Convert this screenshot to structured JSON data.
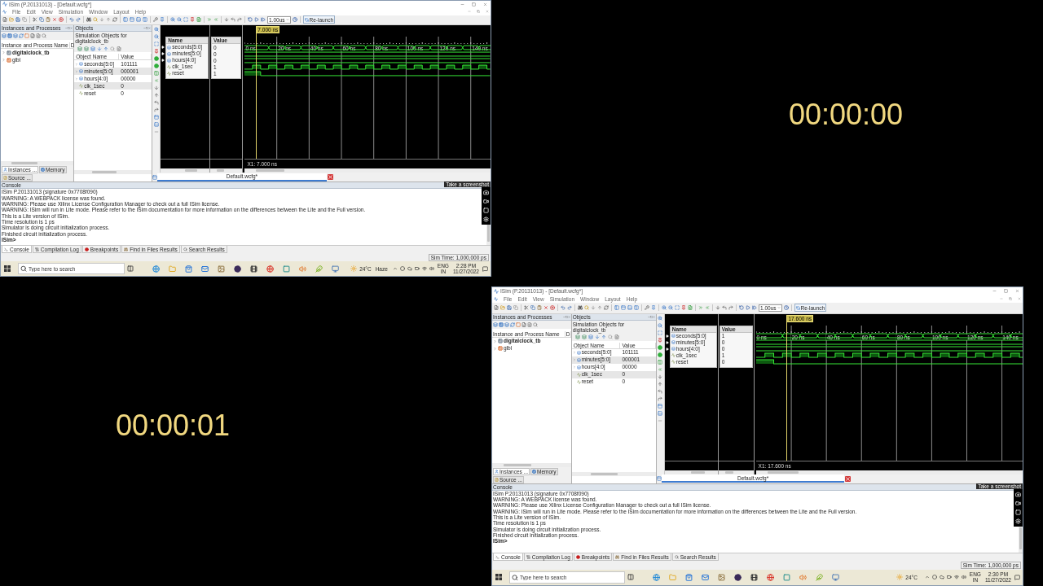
{
  "frames": [
    {
      "kind": "window",
      "title": "ISim (P.20131013) - [Default.wcfg*]",
      "menu": [
        "File",
        "Edit",
        "View",
        "Simulation",
        "Window",
        "Layout",
        "Help"
      ],
      "toolbar": {
        "run_time": "1.00us",
        "relaunch": "Re-launch"
      },
      "instances": {
        "title": "Instances and Processes",
        "columns": [
          "Instance and Process Name",
          "D"
        ],
        "items": [
          {
            "name": "digitalclock_tb",
            "kind": "top",
            "expanded": false
          },
          {
            "name": "glbl",
            "kind": "module",
            "expanded": false
          }
        ],
        "tabs": [
          {
            "label": "Instances ...",
            "selected": true
          },
          {
            "label": "Memory",
            "selected": false
          },
          {
            "label": "Source ...",
            "selected": false
          }
        ]
      },
      "objects": {
        "title": "Objects",
        "subtitle": "Simulation Objects for digitalclock_tb",
        "columns": [
          "Object Name",
          "Value"
        ],
        "rows": [
          {
            "name": "seconds[5:0]",
            "value": "101111",
            "kind": "bus"
          },
          {
            "name": "minutes[5:0]",
            "value": "000001",
            "kind": "bus"
          },
          {
            "name": "hours[4:0]",
            "value": "00000",
            "kind": "bus"
          },
          {
            "name": "clk_1sec",
            "value": "0",
            "kind": "bit"
          },
          {
            "name": "reset",
            "value": "0",
            "kind": "bit"
          }
        ]
      },
      "wave": {
        "columns": [
          "Name",
          "Value"
        ],
        "signals": [
          {
            "name": "seconds[5:0]",
            "value": "0",
            "kind": "bus"
          },
          {
            "name": "minutes[5:0]",
            "value": "0",
            "kind": "steady_bus"
          },
          {
            "name": "hours[4:0]",
            "value": "0",
            "kind": "steady_bus"
          },
          {
            "name": "clk_1sec",
            "value": "1",
            "kind": "clock"
          },
          {
            "name": "reset",
            "value": "1",
            "kind": "pulse"
          }
        ],
        "ticks": [
          "0 ns",
          "20 ns",
          "40 ns",
          "60 ns",
          "80 ns",
          "100 ns",
          "120 ns",
          "140 ns"
        ],
        "cursor": "7.000 ns",
        "readout": "X1: 7.000 ns",
        "tab": "Default.wcfg*"
      },
      "console": {
        "title": "Console",
        "lines": [
          "ISim P.20131013 (signature 0x7708f090)",
          "WARNING: A WEBPACK license was found.",
          "WARNING: Please use Xilinx License Configuration Manager to check out a full ISim license.",
          "WARNING: ISim will run in Lite mode. Please refer to the ISim documentation for more information on the differences between the Lite and the Full version.",
          "This is a Lite version of ISim.",
          "Time resolution is 1 ps",
          "Simulator is doing circuit initialization process.",
          "Finished circuit initialization process."
        ],
        "prompt": "ISim>",
        "tabs": [
          {
            "label": "Console",
            "selected": true
          },
          {
            "label": "Compilation Log",
            "selected": false
          },
          {
            "label": "Breakpoints",
            "selected": false
          },
          {
            "label": "Find in Files Results",
            "selected": false
          },
          {
            "label": "Search Results",
            "selected": false
          }
        ]
      },
      "status": "Sim Time: 1,000,000 ps",
      "taskbar": {
        "search": {
          "placeholder": "Type here to search"
        },
        "weather": {
          "temperature": "24°C",
          "condition": "Haze"
        },
        "language": "ENG",
        "region": "IN",
        "time": "2:28 PM",
        "date": "11/27/2022"
      },
      "screenshot_tooltip": "Take a screenshot"
    },
    {
      "kind": "timer",
      "text": "00:00:00"
    },
    {
      "kind": "timer",
      "text": "00:00:01"
    },
    {
      "kind": "window",
      "title": "ISim (P.20131013) - [Default.wcfg*]",
      "menu": [
        "File",
        "Edit",
        "View",
        "Simulation",
        "Window",
        "Layout",
        "Help"
      ],
      "toolbar": {
        "run_time": "1.00us",
        "relaunch": "Re-launch"
      },
      "instances": {
        "title": "Instances and Processes",
        "columns": [
          "Instance and Process Name",
          "D"
        ],
        "items": [
          {
            "name": "digitalclock_tb",
            "kind": "top",
            "expanded": false
          },
          {
            "name": "glbl",
            "kind": "module",
            "expanded": false
          }
        ],
        "tabs": [
          {
            "label": "Instances ...",
            "selected": true
          },
          {
            "label": "Memory",
            "selected": false
          },
          {
            "label": "Source ...",
            "selected": false
          }
        ]
      },
      "objects": {
        "title": "Objects",
        "subtitle": "Simulation Objects for digitalclock_tb",
        "columns": [
          "Object Name",
          "Value"
        ],
        "rows": [
          {
            "name": "seconds[5:0]",
            "value": "101111",
            "kind": "bus"
          },
          {
            "name": "minutes[5:0]",
            "value": "000001",
            "kind": "bus"
          },
          {
            "name": "hours[4:0]",
            "value": "00000",
            "kind": "bus"
          },
          {
            "name": "clk_1sec",
            "value": "0",
            "kind": "bit"
          },
          {
            "name": "reset",
            "value": "0",
            "kind": "bit"
          }
        ]
      },
      "wave": {
        "columns": [
          "Name",
          "Value"
        ],
        "signals": [
          {
            "name": "seconds[5:0]",
            "value": "1",
            "kind": "bus"
          },
          {
            "name": "minutes[5:0]",
            "value": "0",
            "kind": "steady_bus"
          },
          {
            "name": "hours[4:0]",
            "value": "0",
            "kind": "steady_bus"
          },
          {
            "name": "clk_1sec",
            "value": "1",
            "kind": "clock"
          },
          {
            "name": "reset",
            "value": "0",
            "kind": "pulse"
          }
        ],
        "ticks": [
          "0 ns",
          "20 ns",
          "40 ns",
          "60 ns",
          "80 ns",
          "100 ns",
          "120 ns",
          "140 ns"
        ],
        "cursor": "17.600 ns",
        "readout": "X1: 17.600 ns",
        "tab": "Default.wcfg*"
      },
      "console": {
        "title": "Console",
        "lines": [
          "ISim P.20131013 (signature 0x7708f090)",
          "WARNING: A WEBPACK license was found.",
          "WARNING: Please use Xilinx License Configuration Manager to check out a full ISim license.",
          "WARNING: ISim will run in Lite mode. Please refer to the ISim documentation for more information on the differences between the Lite and the Full version.",
          "This is a Lite version of ISim.",
          "Time resolution is 1 ps",
          "Simulator is doing circuit initialization process.",
          "Finished circuit initialization process."
        ],
        "prompt": "ISim>",
        "tabs": [
          {
            "label": "Console",
            "selected": true
          },
          {
            "label": "Compilation Log",
            "selected": false
          },
          {
            "label": "Breakpoints",
            "selected": false
          },
          {
            "label": "Find in Files Results",
            "selected": false
          },
          {
            "label": "Search Results",
            "selected": false
          }
        ]
      },
      "status": "Sim Time: 1,000,000 ps",
      "taskbar": {
        "search": {
          "placeholder": "Type here to search"
        },
        "weather": {
          "temperature": "24°C"
        },
        "language": "ENG",
        "region": "IN",
        "time": "2:30 PM",
        "date": "11/27/2022"
      },
      "screenshot_tooltip": "Take a screenshot"
    }
  ]
}
